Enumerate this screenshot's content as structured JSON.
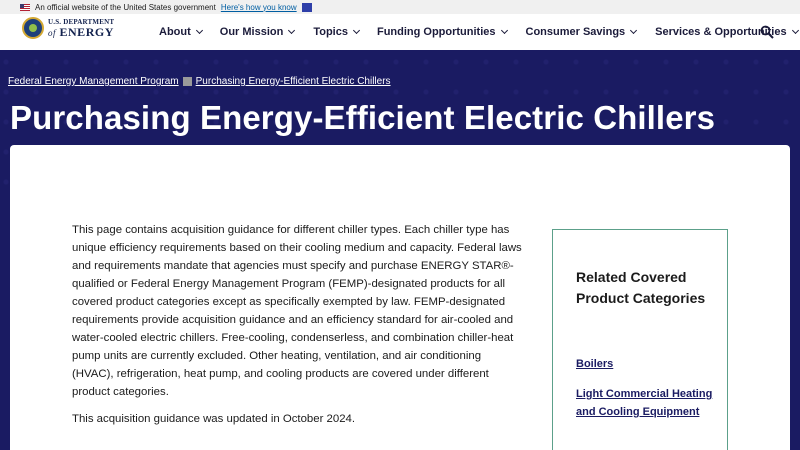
{
  "gov_banner": {
    "text": "An official website of the United States government",
    "link": "Here's how you know"
  },
  "header": {
    "logo_top": "U.S. DEPARTMENT",
    "logo_of": "of",
    "logo_bottom": "ENERGY",
    "nav": [
      {
        "label": "About"
      },
      {
        "label": "Our Mission"
      },
      {
        "label": "Topics"
      },
      {
        "label": "Funding Opportunities"
      },
      {
        "label": "Consumer Savings"
      },
      {
        "label": "Services & Opportunities"
      }
    ],
    "search_icon": "search-icon"
  },
  "hero": {
    "breadcrumb": [
      "Federal Energy Management Program",
      "Purchasing Energy-Efficient Electric Chillers"
    ],
    "title": "Purchasing Energy-Efficient Electric Chillers"
  },
  "main": {
    "intro": "This page contains acquisition guidance for different chiller types. Each chiller type has unique efficiency requirements based on their cooling medium and capacity. Federal laws and requirements mandate that agencies must specify and purchase ENERGY STAR®-qualified or Federal Energy Management Program (FEMP)-designated products for all covered product categories except as specifically exempted by law. FEMP-designated requirements provide acquisition guidance and an efficiency standard for air-cooled and water-cooled electric chillers. Free-cooling, condenserless, and combination chiller-heat pump units are currently excluded. Other heating, ventilation, and air conditioning (HVAC), refrigeration, heat pump, and cooling products are covered under different product categories.",
    "updated": "This acquisition guidance was updated in October 2024."
  },
  "related": {
    "title": "Related Covered Product Categories",
    "links": [
      "Boilers",
      "Light Commercial Heating and Cooling Equipment"
    ]
  },
  "colors": {
    "hero_bg": "#1a1b62",
    "link": "#1a1b62",
    "border_accent": "#5ca08a"
  }
}
